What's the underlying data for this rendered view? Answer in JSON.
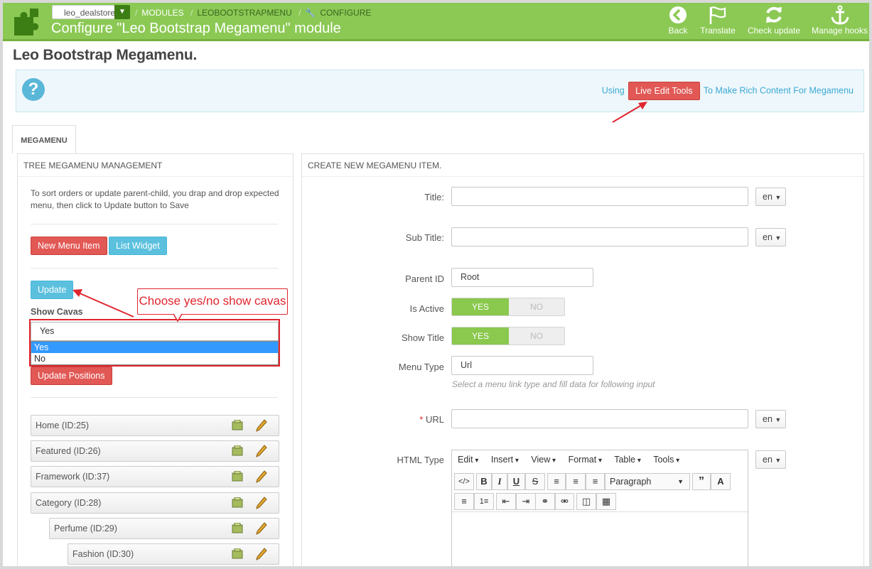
{
  "header": {
    "store_selector": "leo_dealstore",
    "breadcrumbs": [
      "MODULES",
      "LEOBOOTSTRAPMENU",
      "CONFIGURE"
    ],
    "page_heading": "Configure \"Leo Bootstrap Megamenu\" module",
    "toolbar": [
      {
        "label": "Back",
        "icon": "back-arrow-icon"
      },
      {
        "label": "Translate",
        "icon": "flag-icon"
      },
      {
        "label": "Check update",
        "icon": "refresh-icon"
      },
      {
        "label": "Manage hooks",
        "icon": "anchor-icon"
      }
    ]
  },
  "title": "Leo Bootstrap Megamenu.",
  "info": {
    "using": "Using",
    "live_edit_button": "Live Edit Tools",
    "suffix": "To Make Rich Content For Megamenu"
  },
  "tab": "MEGAMENU",
  "left_panel": {
    "heading": "TREE MEGAMENU MANAGEMENT",
    "help_text": "To sort orders or update parent-child, you drap and drop expected menu, then click to Update button to Save",
    "new_menu_item": "New Menu Item",
    "list_widget": "List Widget",
    "update": "Update",
    "show_cavas_label": "Show Cavas",
    "show_cavas_value": "Yes",
    "show_cavas_options": [
      "Yes",
      "No"
    ],
    "update_positions": "Update Positions",
    "callout": "Choose yes/no show cavas",
    "tree": [
      {
        "label": "Home (ID:25)",
        "level": 0
      },
      {
        "label": "Featured (ID:26)",
        "level": 0
      },
      {
        "label": "Framework (ID:37)",
        "level": 0
      },
      {
        "label": "Category (ID:28)",
        "level": 0
      },
      {
        "label": "Perfume (ID:29)",
        "level": 1
      },
      {
        "label": "Fashion (ID:30)",
        "level": 2
      }
    ]
  },
  "right_panel": {
    "heading": "CREATE NEW MEGAMENU ITEM.",
    "title_label": "Title:",
    "subtitle_label": "Sub Title:",
    "parent_label": "Parent ID",
    "parent_value": "Root",
    "active_label": "Is Active",
    "show_title_label": "Show Title",
    "yes": "YES",
    "no": "NO",
    "menu_type_label": "Menu Type",
    "menu_type_value": "Url",
    "menu_type_hint": "Select a menu link type and fill data for following input",
    "url_label": "URL",
    "required_mark": "*",
    "html_type_label": "HTML Type",
    "lang": "en",
    "editor_menus": [
      "Edit",
      "Insert",
      "View",
      "Format",
      "Table",
      "Tools"
    ],
    "paragraph": "Paragraph"
  },
  "colors": {
    "header_green": "#8bc954",
    "danger_red": "#e15855",
    "info_cyan": "#5bc0de",
    "annotation_red": "#e0252e"
  }
}
